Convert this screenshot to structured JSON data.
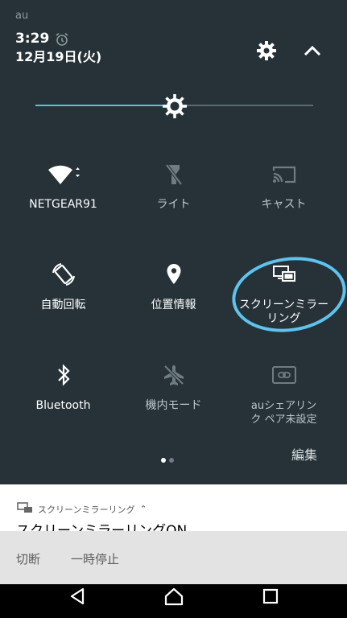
{
  "status": {
    "carrier": "au",
    "time": "3:29",
    "date": "12月19日(火)"
  },
  "brightness": {
    "level": 0.5
  },
  "tiles": [
    {
      "label": "NETGEAR91",
      "icon": "wifi-icon",
      "active": true
    },
    {
      "label": "ライト",
      "icon": "flashlight-off-icon",
      "active": false
    },
    {
      "label": "キャスト",
      "icon": "cast-icon",
      "active": false
    },
    {
      "label": "自動回転",
      "icon": "auto-rotate-icon",
      "active": true
    },
    {
      "label": "位置情報",
      "icon": "location-pin-icon",
      "active": true
    },
    {
      "label": "スクリーンミラーリング",
      "icon": "screen-mirroring-icon",
      "active": true
    },
    {
      "label": "Bluetooth",
      "icon": "bluetooth-icon",
      "active": true
    },
    {
      "label": "機内モード",
      "icon": "airplane-mode-icon",
      "active": false
    },
    {
      "label": "auシェアリンク ペア未設定",
      "icon": "au-share-link-icon",
      "active": false
    }
  ],
  "pager": {
    "pages": 2,
    "current": 1
  },
  "edit_label": "編集",
  "notification": {
    "app_name": "スクリーンミラーリング",
    "title": "スクリーンミラーリングON",
    "actions": [
      "切断",
      "一時停止"
    ]
  },
  "colors": {
    "panel": "#263238",
    "accent": "#4dc7d6",
    "annotation": "#5fc3ee"
  }
}
